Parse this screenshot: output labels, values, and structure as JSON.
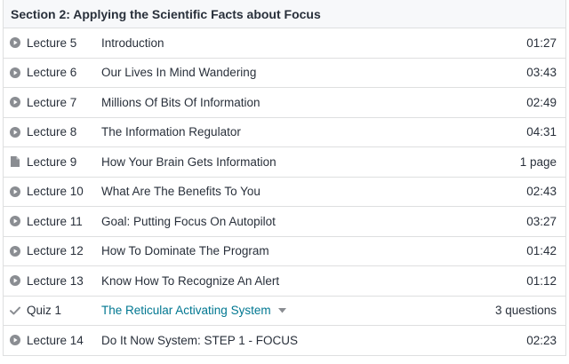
{
  "section": {
    "title": "Section 2: Applying the Scientific Facts about Focus"
  },
  "items": [
    {
      "icon": "play-circle-icon",
      "number": "Lecture 5",
      "title": "Introduction",
      "meta": "01:27"
    },
    {
      "icon": "play-circle-icon",
      "number": "Lecture 6",
      "title": "Our Lives In Mind Wandering",
      "meta": "03:43"
    },
    {
      "icon": "play-circle-icon",
      "number": "Lecture 7",
      "title": "Millions Of Bits Of Information",
      "meta": "02:49"
    },
    {
      "icon": "play-circle-icon",
      "number": "Lecture 8",
      "title": "The Information Regulator",
      "meta": "04:31"
    },
    {
      "icon": "document-icon",
      "number": "Lecture 9",
      "title": "How Your Brain Gets Information",
      "meta": "1 page"
    },
    {
      "icon": "play-circle-icon",
      "number": "Lecture 10",
      "title": "What Are The Benefits To You",
      "meta": "02:43"
    },
    {
      "icon": "play-circle-icon",
      "number": "Lecture 11",
      "title": "Goal: Putting Focus On Autopilot",
      "meta": "03:27"
    },
    {
      "icon": "play-circle-icon",
      "number": "Lecture 12",
      "title": "How To Dominate The Program",
      "meta": "01:42"
    },
    {
      "icon": "play-circle-icon",
      "number": "Lecture 13",
      "title": "Know How To Recognize An Alert",
      "meta": "01:12"
    },
    {
      "icon": "checkmark-icon",
      "number": "Quiz 1",
      "title": "The Reticular Activating System",
      "meta": "3 questions"
    },
    {
      "icon": "play-circle-icon",
      "number": "Lecture 14",
      "title": "Do It Now System: STEP 1 - FOCUS",
      "meta": "02:23"
    }
  ],
  "colors": {
    "icon_gray": "#8a8d92",
    "link": "#007791",
    "border": "#dedfe0",
    "header_bg": "#f7f8fa"
  }
}
